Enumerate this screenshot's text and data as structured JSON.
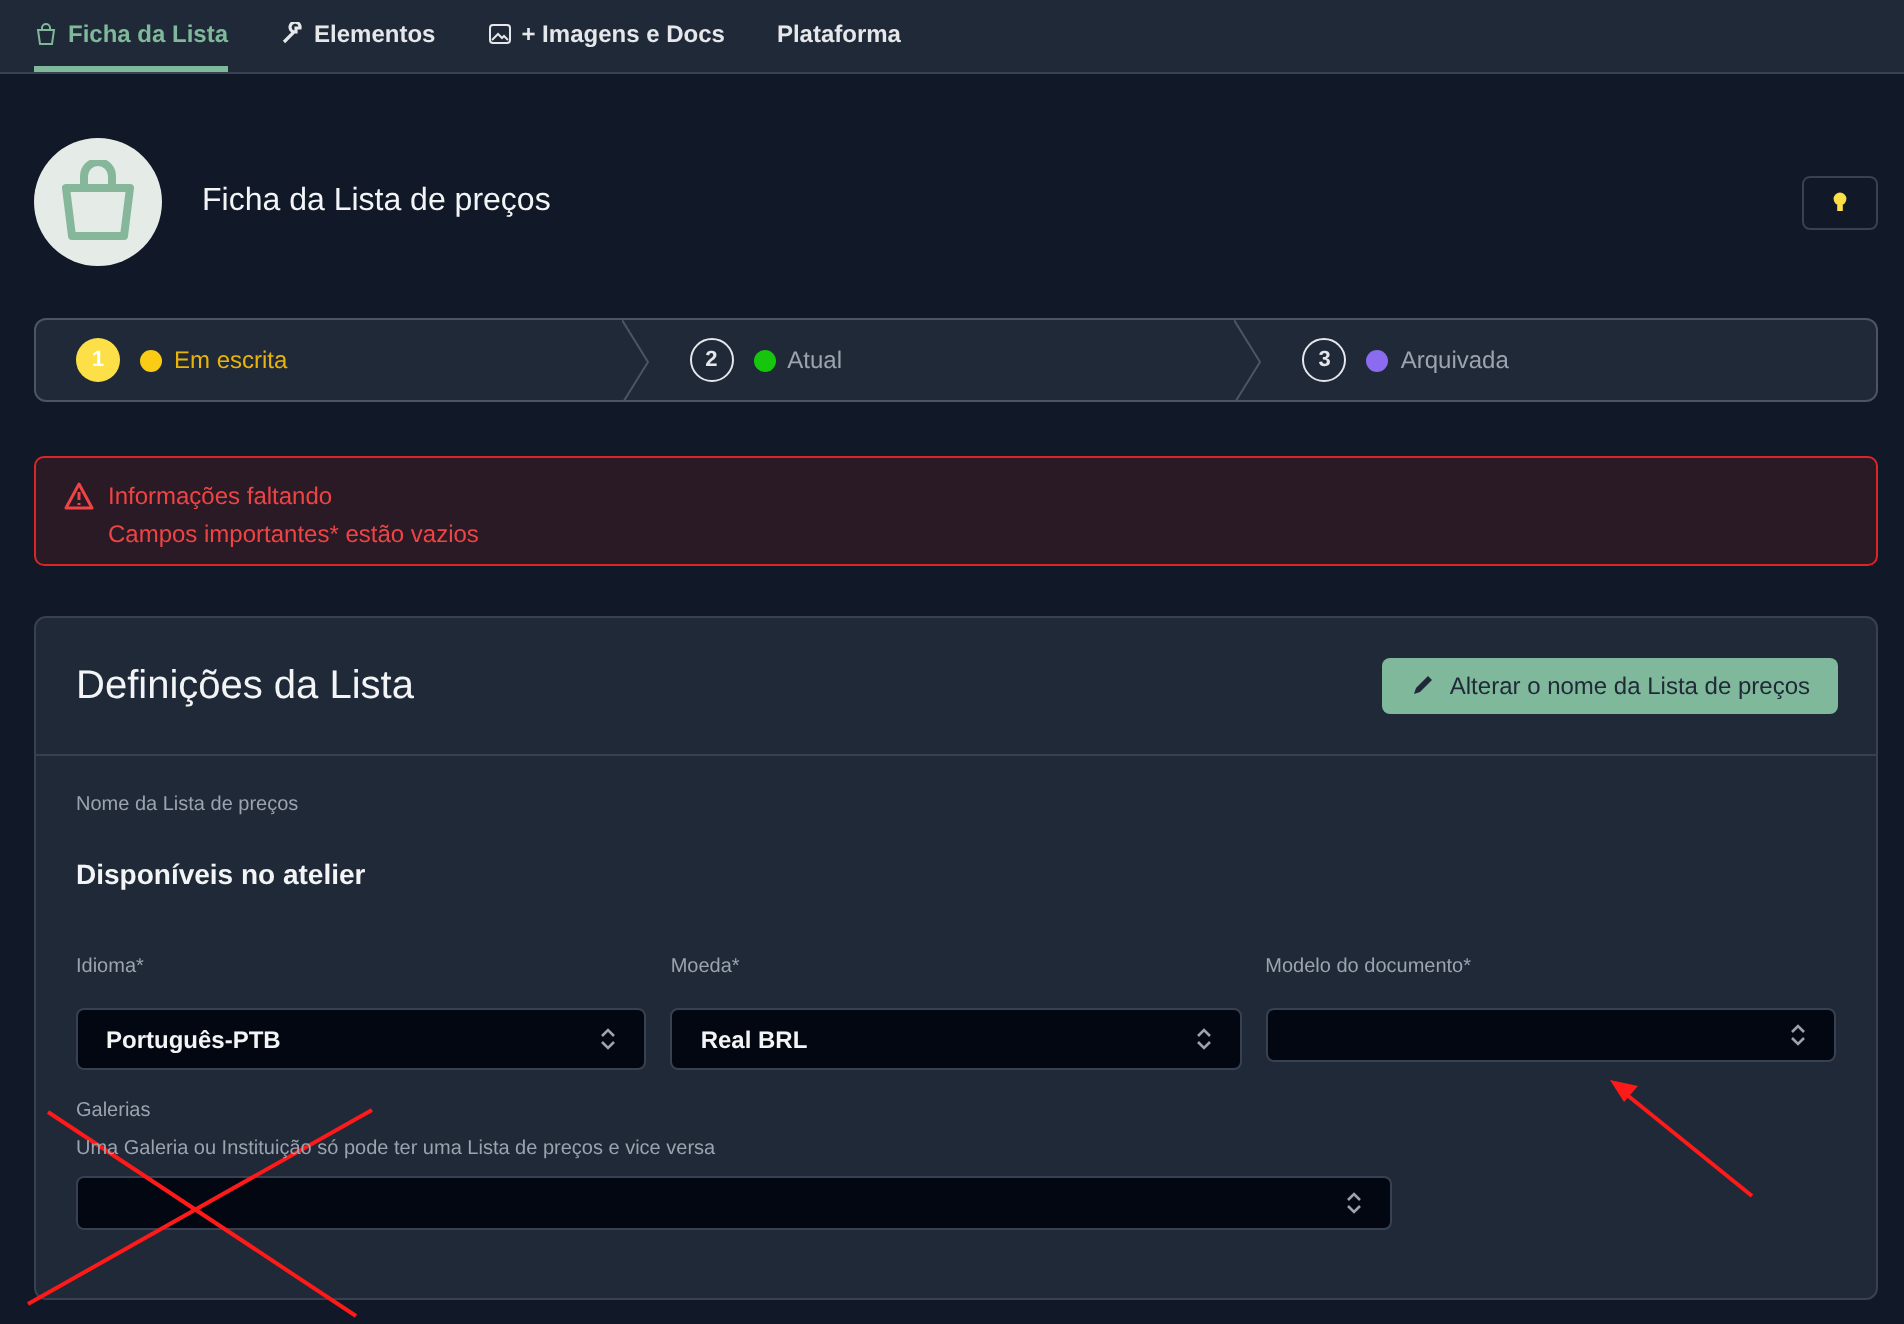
{
  "tabs": [
    {
      "label": "Ficha da Lista",
      "selected": true
    },
    {
      "label": "Elementos",
      "selected": false
    },
    {
      "label": "+ Imagens e Docs",
      "selected": false
    },
    {
      "label": "Plataforma",
      "selected": false
    }
  ],
  "header": {
    "title": "Ficha da Lista de preços"
  },
  "steps": [
    {
      "number": "1",
      "label": "Em escrita",
      "color": "#facc15",
      "selected": true
    },
    {
      "number": "2",
      "label": "Atual",
      "color": "#16c60c",
      "selected": false
    },
    {
      "number": "3",
      "label": "Arquivada",
      "color": "#8b6cf0",
      "selected": false
    }
  ],
  "alert": {
    "title": "Informações faltando",
    "message": "Campos importantes* estão vazios"
  },
  "card": {
    "title": "Definições da Lista",
    "button": "Alterar o nome da Lista de preços",
    "name_label": "Nome da Lista de preços",
    "name_value": "Disponíveis no atelier",
    "fields": [
      {
        "label": "Idioma*",
        "value": "Português-PTB"
      },
      {
        "label": "Moeda*",
        "value": "Real BRL"
      },
      {
        "label": "Modelo do documento*"
      }
    ],
    "galleries": {
      "label": "Galerias",
      "hint": "Uma Galeria ou Instituição só pode ter uma Lista de preços e vice versa"
    }
  }
}
